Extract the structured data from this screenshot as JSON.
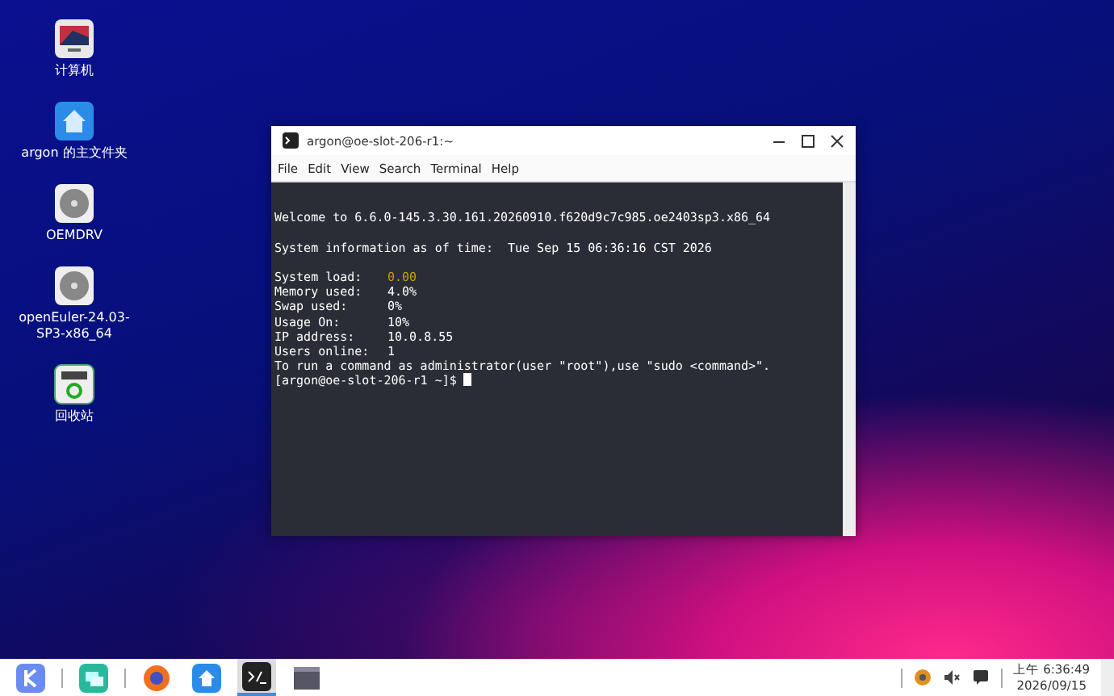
{
  "desktop_icons": [
    {
      "kind": "computer",
      "label": "计算机"
    },
    {
      "kind": "home",
      "label": "argon 的主文件夹"
    },
    {
      "kind": "disc",
      "label": "OEMDRV"
    },
    {
      "kind": "disc",
      "label": "openEuler-24.03-SP3-x86_64"
    },
    {
      "kind": "trash",
      "label": "回收站"
    }
  ],
  "window": {
    "title": "argon@oe-slot-206-r1:~",
    "menu": [
      "File",
      "Edit",
      "View",
      "Search",
      "Terminal",
      "Help"
    ],
    "lines": [
      {
        "kind": "blank"
      },
      {
        "kind": "text",
        "text": "Welcome to 6.6.0-145.3.30.161.20260910.f620d9c7c985.oe2403sp3.x86_64"
      },
      {
        "kind": "blank"
      },
      {
        "kind": "text",
        "text": "System information as of time:  Tue Sep 15 06:36:16 CST 2026"
      },
      {
        "kind": "blank"
      },
      {
        "kind": "field",
        "label": "System load:",
        "value": "0.00",
        "color": "#c8a000"
      },
      {
        "kind": "field",
        "label": "Memory used:",
        "value": "4.0%",
        "color": "#ffffff"
      },
      {
        "kind": "field",
        "label": "Swap used:",
        "value": "0%",
        "color": "#ffffff"
      },
      {
        "kind": "field",
        "label": "Usage On:",
        "value": "10%",
        "color": "#ffffff"
      },
      {
        "kind": "field",
        "label": "IP address:",
        "value": "10.0.8.55",
        "color": "#ffffff"
      },
      {
        "kind": "field",
        "label": "Users online:",
        "value": "1",
        "color": "#ffffff"
      },
      {
        "kind": "text",
        "text": "To run a command as administrator(user \"root\"),use \"sudo <command>\"."
      },
      {
        "kind": "prompt",
        "text": "[argon@oe-slot-206-r1 ~]$"
      }
    ]
  },
  "taskbar": {
    "items": [
      {
        "kind": "start",
        "selected": false
      },
      {
        "kind": "sep"
      },
      {
        "kind": "multitask",
        "selected": false
      },
      {
        "kind": "sep"
      },
      {
        "kind": "browser",
        "selected": false
      },
      {
        "kind": "files",
        "selected": false
      },
      {
        "kind": "terminal",
        "selected": true
      },
      {
        "kind": "window",
        "selected": false
      }
    ],
    "time": "上午 6:36:49",
    "date": "2026/09/15"
  }
}
